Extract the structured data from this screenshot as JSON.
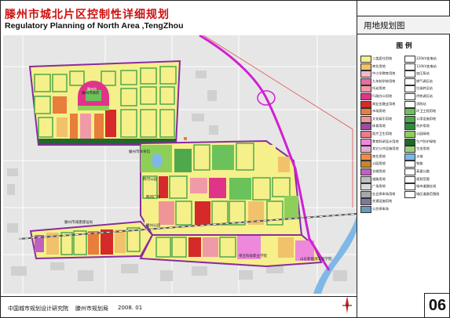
{
  "header": {
    "title_cn": "滕州市城北片区控制性详细规划",
    "title_en": "Regulatory Planning of North Area ,TengZhou"
  },
  "panel": {
    "title": "用地规划图",
    "legend_title": "图 例",
    "sheet_no": "06"
  },
  "footer": {
    "org1": "中国城市规划设计研究院",
    "org2": "滕州市规划局",
    "date": "2008. 01"
  },
  "map_labels": {
    "label_a": "滕州市体育馆",
    "label_b": "荆河公园",
    "label_c": "滕州市政府",
    "label_d": "荆河广场",
    "label_e": "滕州市城建建设局",
    "label_f": "滕州公园",
    "label_g": "枣庄科技职业学院",
    "label_h": "山东新能源工程学院"
  },
  "legend": {
    "col1": [
      {
        "label": "二类居住用地",
        "color": "#f5f08a"
      },
      {
        "label": "商住用地",
        "color": "#f1c16c"
      },
      {
        "label": "中小学教育用地",
        "color": "#f9b6c8"
      },
      {
        "label": "九年制学校用地",
        "color": "#e86ea0"
      },
      {
        "label": "托幼用地",
        "color": "#f09aa8"
      },
      {
        "label": "行政办公用地",
        "color": "#e0348a"
      },
      {
        "label": "商业金融业用地",
        "color": "#d62a2a"
      },
      {
        "label": "市场用地",
        "color": "#e77e3b"
      },
      {
        "label": "文化娱乐用地",
        "color": "#f09595"
      },
      {
        "label": "体育用地",
        "color": "#9a4ea0"
      },
      {
        "label": "医疗卫生用地",
        "color": "#f07a8a"
      },
      {
        "label": "教育科研设计用地",
        "color": "#ee88dd"
      },
      {
        "label": "其它公共设施用地",
        "color": "#e8a8d0"
      },
      {
        "label": "商住用地",
        "color": "#f08c48"
      },
      {
        "label": "公园用地",
        "color": "#c5862d"
      },
      {
        "label": "仓储用地",
        "color": "#c060c0"
      },
      {
        "label": "道路用地",
        "color": "#bfbfbf"
      },
      {
        "label": "广场用地",
        "color": "#d8d8d8"
      },
      {
        "label": "社会停车场用地",
        "color": "#a8a8a8"
      },
      {
        "label": "交通设施用地",
        "color": "#7a7a9a"
      },
      {
        "label": "公交停车场",
        "color": "#6a9ab8"
      }
    ],
    "col2": [
      {
        "label": "220kV变电站",
        "color": "#ffffff"
      },
      {
        "label": "110kV变电站",
        "color": "#ffffff"
      },
      {
        "label": "加压泵站",
        "color": "#ffffff"
      },
      {
        "label": "燃气调压站",
        "color": "#ffffff"
      },
      {
        "label": "垃圾转运站",
        "color": "#ffffff"
      },
      {
        "label": "供热调压站",
        "color": "#ffffff"
      },
      {
        "label": "消防站",
        "color": "#ffffff"
      },
      {
        "label": "环卫工程用地",
        "color": "#6cc25a"
      },
      {
        "label": "公用设施用地",
        "color": "#4fa84c"
      },
      {
        "label": "防护用地",
        "color": "#2e8b3e"
      },
      {
        "label": "公园绿地",
        "color": "#8ecf5a"
      },
      {
        "label": "生产防护绿地",
        "color": "#1f6a2a"
      },
      {
        "label": "生态用地",
        "color": "#9ccf7a"
      },
      {
        "label": "水域",
        "color": "#7fb8e6"
      },
      {
        "label": "铁路",
        "color": "#ffffff"
      },
      {
        "label": "高速公路",
        "color": "#ffffff"
      },
      {
        "label": "规划范围",
        "color": "#ffffff"
      },
      {
        "label": "城市道路红线",
        "color": "#ffffff"
      },
      {
        "label": "城区道路范围线",
        "color": "#ffffff"
      }
    ]
  }
}
